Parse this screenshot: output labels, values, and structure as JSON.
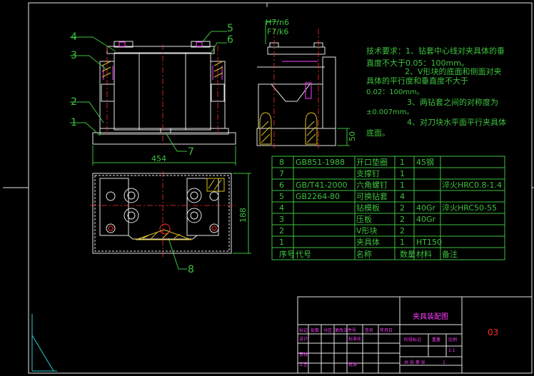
{
  "callouts": {
    "c1": "1",
    "c2": "2",
    "c3": "3",
    "c4": "4",
    "c5": "5",
    "c6": "6",
    "c7": "7",
    "c8": "8"
  },
  "dimensions": {
    "width_454": "454",
    "height_188": "188",
    "height_50": "50",
    "fit_1": "H7/n6",
    "fit_2": "F7/k6"
  },
  "tech_req": {
    "lines": [
      "技术要求：1、钻套中心线对夹具体的垂",
      "直度不大于0.05：100mm。",
      "2、V形块的底面和侧面对夹",
      "具体的平行度和垂直度不大于",
      "0.02：100mm。",
      "3、两钻套之间的对称度为",
      "±0.007mm。",
      "4、对刀块水平面平行夹具体",
      "底面。"
    ]
  },
  "bom": {
    "rows": [
      {
        "no": "8",
        "code": "GB851-1988",
        "name": "开口垫圈",
        "qty": "1",
        "material": "45钢",
        "note": ""
      },
      {
        "no": "7",
        "code": "",
        "name": "支撑钉",
        "qty": "1",
        "material": "",
        "note": ""
      },
      {
        "no": "6",
        "code": "GB/T41-2000",
        "name": "六角螺钉",
        "qty": "1",
        "material": "",
        "note": "淬火HRC0.8-1.4"
      },
      {
        "no": "5",
        "code": "GB2264-80",
        "name": "可换钻套",
        "qty": "4",
        "material": "",
        "note": ""
      },
      {
        "no": "4",
        "code": "",
        "name": "钻模板",
        "qty": "2",
        "material": "40Gr",
        "note": "淬火HRC50-55"
      },
      {
        "no": "3",
        "code": "",
        "name": "压板",
        "qty": "2",
        "material": "40Gr",
        "note": ""
      },
      {
        "no": "2",
        "code": "",
        "name": "V形块",
        "qty": "2",
        "material": "",
        "note": ""
      },
      {
        "no": "1",
        "code": "",
        "name": "夹具体",
        "qty": "1",
        "material": "HT150",
        "note": ""
      }
    ],
    "header": {
      "no": "序号",
      "code": "代号",
      "name": "名称",
      "qty": "数量",
      "material": "材料",
      "note": "备注"
    }
  },
  "title_block": {
    "title": "夹具装配图",
    "drawing_no": "03",
    "r1": [
      "标记",
      "处数",
      "分区",
      "更改文件号",
      "签名",
      "年月日"
    ],
    "design": "设计",
    "std": "标准化",
    "stage": "阶段标记",
    "weight": "重量",
    "scale": "比例",
    "check": "审核",
    "craft": "工艺",
    "approve": "批准",
    "sheets": "共  张 第  张",
    "scale_val": "1:1",
    "sheet_count": "1"
  },
  "colors": {
    "green": "#3ec13e",
    "white": "#e6e6e6",
    "red": "#ff2b2b",
    "magenta": "#ff3cff",
    "yellow": "#e0c020",
    "cyan": "#30c8d0"
  }
}
